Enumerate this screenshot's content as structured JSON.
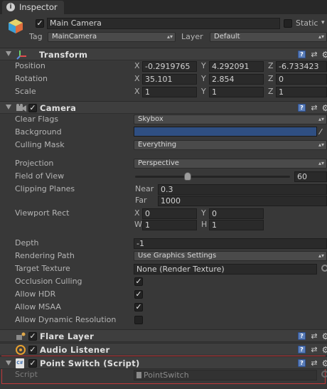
{
  "tab": {
    "title": "Inspector"
  },
  "object": {
    "name": "Main Camera",
    "active": true,
    "static_label": "Static",
    "tag_label": "Tag",
    "tag_value": "MainCamera",
    "layer_label": "Layer",
    "layer_value": "Default"
  },
  "transform": {
    "title": "Transform",
    "position_label": "Position",
    "rotation_label": "Rotation",
    "scale_label": "Scale",
    "position": {
      "x": "-0.2919765",
      "y": "4.292091",
      "z": "-6.733423"
    },
    "rotation": {
      "x": "35.101",
      "y": "2.854",
      "z": "0"
    },
    "scale": {
      "x": "1",
      "y": "1",
      "z": "1"
    },
    "axis_x": "X",
    "axis_y": "Y",
    "axis_z": "Z"
  },
  "camera": {
    "title": "Camera",
    "enabled": true,
    "clear_flags_label": "Clear Flags",
    "clear_flags_value": "Skybox",
    "background_label": "Background",
    "background_color": "#2f4f82",
    "culling_mask_label": "Culling Mask",
    "culling_mask_value": "Everything",
    "projection_label": "Projection",
    "projection_value": "Perspective",
    "fov_label": "Field of View",
    "fov_value": "60",
    "fov_fraction": 0.34,
    "clipping_label": "Clipping Planes",
    "near_label": "Near",
    "near_value": "0.3",
    "far_label": "Far",
    "far_value": "1000",
    "viewport_label": "Viewport Rect",
    "vp_x_label": "X",
    "vp_x": "0",
    "vp_y_label": "Y",
    "vp_y": "0",
    "vp_w_label": "W",
    "vp_w": "1",
    "vp_h_label": "H",
    "vp_h": "1",
    "depth_label": "Depth",
    "depth_value": "-1",
    "rendering_path_label": "Rendering Path",
    "rendering_path_value": "Use Graphics Settings",
    "target_texture_label": "Target Texture",
    "target_texture_value": "None (Render Texture)",
    "occlusion_label": "Occlusion Culling",
    "occlusion_checked": true,
    "hdr_label": "Allow HDR",
    "hdr_checked": true,
    "msaa_label": "Allow MSAA",
    "msaa_checked": true,
    "dynres_label": "Allow Dynamic Resolution",
    "dynres_checked": false
  },
  "flare_layer": {
    "title": "Flare Layer",
    "enabled": true
  },
  "audio_listener": {
    "title": "Audio Listener",
    "enabled": true
  },
  "point_switch": {
    "title": "Point Switch (Script)",
    "enabled": true,
    "script_label": "Script",
    "script_value": "PointSwitch"
  },
  "icons": {
    "help": "?",
    "check": "✓",
    "dropdown": "▴▾"
  }
}
